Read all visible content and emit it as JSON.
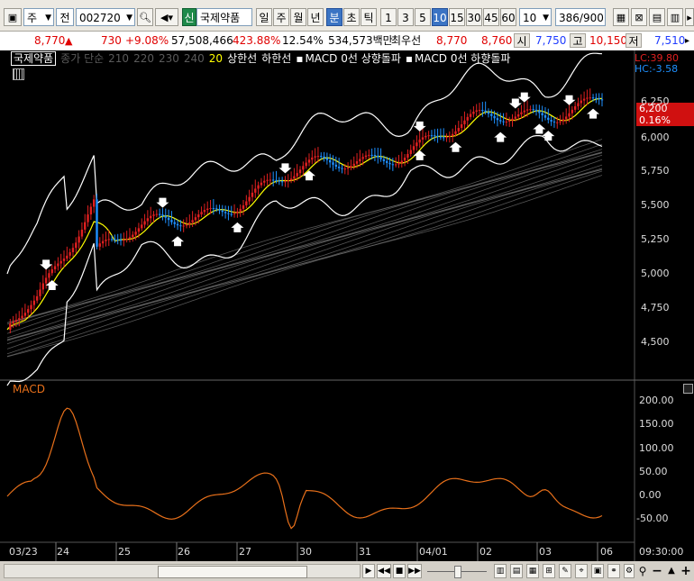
{
  "toolbar": {
    "market_type": "주",
    "prev_label": "전",
    "stock_code": "002720",
    "credit_badge": "신",
    "stock_name": "국제약품",
    "period_tabs": [
      "일",
      "주",
      "월",
      "년",
      "분",
      "초",
      "틱"
    ],
    "selected_period": "분",
    "interval_buttons": [
      "1",
      "3",
      "5",
      "10",
      "15",
      "30",
      "45",
      "60"
    ],
    "selected_interval": "10",
    "interval_select": "10",
    "page_counter": "386/900"
  },
  "quote": {
    "price": "8,770",
    "change": "730",
    "change_pct": "+9.08%",
    "volume": "57,508,466",
    "volume_ratio": "423.88%",
    "turnover": "12.54%",
    "amount": "534,573백만",
    "priority_label": "최우선",
    "best_ask": "8,770",
    "best_bid": "8,760",
    "open_label": "시",
    "open": "7,750",
    "high_label": "고",
    "high": "10,150",
    "low_label": "저",
    "low": "7,510"
  },
  "legend": {
    "name_box": "국제약품",
    "ma_label": "종가 단순",
    "ma_periods": [
      "210",
      "220",
      "230",
      "240",
      "20"
    ],
    "band_upper": "상한선",
    "band_lower": "하한선",
    "signal_up": "MACD 0선 상향돌파",
    "signal_down": "MACD 0선 하향돌파"
  },
  "price_axis": {
    "lc_label": "LC:39.80",
    "hc_label": "HC:-3.58",
    "current_price": "6,200",
    "current_pct": "0.16%",
    "ticks": [
      "6,250",
      "6,000",
      "5,750",
      "5,500",
      "5,250",
      "5,000",
      "4,750",
      "4,500"
    ]
  },
  "macd": {
    "label": "MACD",
    "ticks": [
      "200.00",
      "150.00",
      "100.00",
      "50.00",
      "0.00",
      "-50.00"
    ]
  },
  "time_axis": {
    "labels": [
      "03/23",
      "24",
      "25",
      "26",
      "27",
      "30",
      "31",
      "04/01",
      "02",
      "03",
      "06"
    ],
    "current_time": "09:30:00"
  },
  "colors": {
    "up": "#e02020",
    "down": "#1e90ff",
    "ma20": "#ffff00",
    "band": "#ffffff",
    "ma_long": "#6a6a6a",
    "macd_line": "#e8701a",
    "quote_red": "#e00000",
    "quote_blue": "#1f3cff"
  }
}
